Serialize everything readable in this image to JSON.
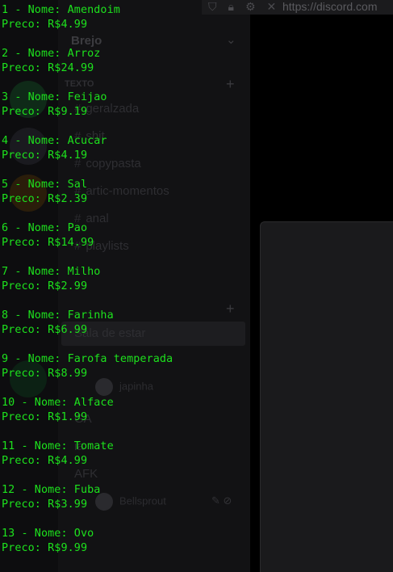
{
  "background": {
    "url_text": "https://discord.com",
    "server_name": "Brejo",
    "category_text": "TEXTO",
    "text_channels": [
      "geralzada",
      "shit",
      "copypasta",
      "artic-momentos",
      "anal",
      "playlists"
    ],
    "voice_channel": "Sala de estar",
    "voice_users": [
      "japinha"
    ],
    "other_channels": [
      "GA",
      "ia",
      "AFK"
    ],
    "current_user": "Bellsprout",
    "colors": {
      "terminal_green": "#1de21d",
      "background": "#000000"
    },
    "icons": [
      "shield-icon",
      "lock-icon",
      "settings-icon",
      "close-icon",
      "chevron-down-icon",
      "plus-icon",
      "mute-icon",
      "deafen-icon"
    ]
  },
  "terminal": {
    "entries": [
      {
        "name_line": "1 - Nome: Amendoim",
        "price_line": "Preco: R$4.99"
      },
      {
        "name_line": "2 - Nome: Arroz",
        "price_line": "Preco: R$24.99"
      },
      {
        "name_line": "3 - Nome: Feijao",
        "price_line": "Preco: R$9.19"
      },
      {
        "name_line": "4 - Nome: Acucar",
        "price_line": "Preco: R$4.19"
      },
      {
        "name_line": "5 - Nome: Sal",
        "price_line": "Preco: R$2.39"
      },
      {
        "name_line": "6 - Nome: Pao",
        "price_line": "Preco: R$14.99"
      },
      {
        "name_line": "7 - Nome: Milho",
        "price_line": "Preco: R$2.99"
      },
      {
        "name_line": "8 - Nome: Farinha",
        "price_line": "Preco: R$6.99"
      },
      {
        "name_line": "9 - Nome: Farofa temperada",
        "price_line": "Preco: R$8.99"
      },
      {
        "name_line": "10 - Nome: Alface",
        "price_line": "Preco: R$1.99"
      },
      {
        "name_line": "11 - Nome: Tomate",
        "price_line": "Preco: R$4.99"
      },
      {
        "name_line": "12 - Nome: Fuba",
        "price_line": "Preco: R$3.99"
      },
      {
        "name_line": "13 - Nome: Ovo",
        "price_line": "Preco: R$9.99"
      }
    ]
  }
}
